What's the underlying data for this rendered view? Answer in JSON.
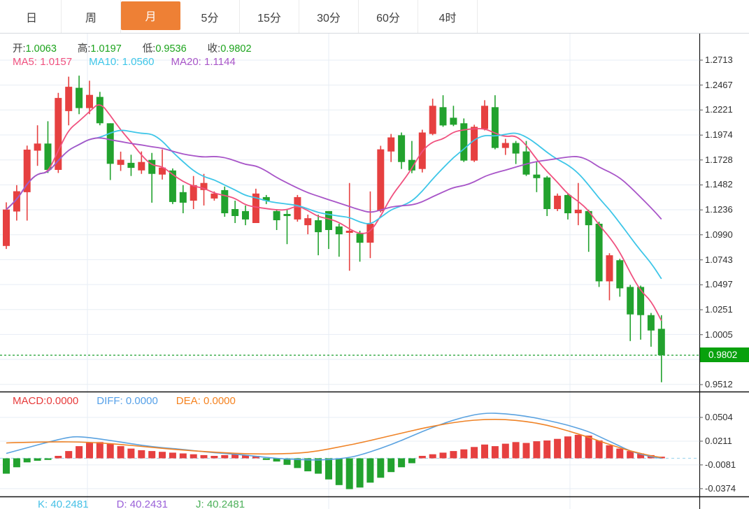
{
  "tabs": {
    "items": [
      {
        "label": "日",
        "selected": false
      },
      {
        "label": "周",
        "selected": false
      },
      {
        "label": "月",
        "selected": true
      },
      {
        "label": "5分",
        "selected": false
      },
      {
        "label": "15分",
        "selected": false
      },
      {
        "label": "30分",
        "selected": false
      },
      {
        "label": "60分",
        "selected": false
      },
      {
        "label": "4时",
        "selected": false
      }
    ]
  },
  "main_chart": {
    "ohlc": {
      "open_label": "开:",
      "open": "1.0063",
      "high_label": "高:",
      "high": "1.0197",
      "low_label": "低:",
      "low": "0.9536",
      "close_label": "收:",
      "close": "0.9802"
    },
    "ma": {
      "ma5_label": "MA5:",
      "ma5": "1.0157",
      "ma10_label": "MA10:",
      "ma10": "1.0560",
      "ma20_label": "MA20:",
      "ma20": "1.1144"
    },
    "y_ticks": [
      "1.2713",
      "1.2467",
      "1.2221",
      "1.1974",
      "1.1728",
      "1.1482",
      "1.1236",
      "1.0990",
      "1.0743",
      "1.0497",
      "1.0251",
      "1.0005",
      "0.9512"
    ],
    "current_price": "0.9802"
  },
  "macd_panel": {
    "macd_label": "MACD:",
    "macd": "0.0000",
    "diff_label": "DIFF:",
    "diff": "0.0000",
    "dea_label": "DEA:",
    "dea": "0.0000",
    "y_ticks": [
      "0.0504",
      "0.0211",
      "-0.0081",
      "-0.0374"
    ]
  },
  "kdj_panel": {
    "k_label": "K:",
    "k": "40.2481",
    "d_label": "D:",
    "d": "40.2431",
    "j_label": "J:",
    "j": "40.2481"
  },
  "colors": {
    "up_red": "#e64040",
    "down_green": "#22a22e",
    "ma5": "#f0517f",
    "ma10": "#3ec6e8",
    "ma20": "#a855c8",
    "diff_line": "#5aa2e0",
    "dea_line": "#ef8327",
    "macd_text": "#e73b3b",
    "diff_text": "#55a0e8",
    "dea_text": "#f5821f",
    "ohlc_value_green": "#1ba31b",
    "label_text": "#3c3c3c",
    "badge_green": "#08a10d",
    "dotted_green": "#2fa640",
    "tab_selected_orange": "#ee8035",
    "k_text": "#45c0e6",
    "d_text": "#9a60d8",
    "j_text": "#4db05a",
    "grid": "#e7edf4",
    "zero_dash": "#a8d8f0",
    "separator": "#141414",
    "axis_text": "#2f2f2f"
  },
  "chart_data": [
    {
      "type": "candlestick",
      "panel": "main",
      "title": "月K线 monthly candles, red = up / green = down",
      "ylim": [
        0.9512,
        1.2713
      ],
      "y_ticks": [
        1.2713,
        1.2467,
        1.2221,
        1.1974,
        1.1728,
        1.1482,
        1.1236,
        1.099,
        1.0743,
        1.0497,
        1.0251,
        1.0005,
        0.9758,
        0.9512
      ],
      "latest": {
        "open": 1.0063,
        "high": 1.0197,
        "low": 0.9536,
        "close": 0.9802
      },
      "ma_latest": {
        "MA5": 1.0157,
        "MA10": 1.056,
        "MA20": 1.1144
      },
      "close_line": 0.9802,
      "ohlc": [
        [
          1.088,
          1.131,
          1.085,
          1.124
        ],
        [
          1.122,
          1.148,
          1.113,
          1.142
        ],
        [
          1.141,
          1.187,
          1.113,
          1.183
        ],
        [
          1.182,
          1.207,
          1.167,
          1.189
        ],
        [
          1.189,
          1.211,
          1.16,
          1.163
        ],
        [
          1.163,
          1.239,
          1.16,
          1.234
        ],
        [
          1.221,
          1.255,
          1.207,
          1.245
        ],
        [
          1.244,
          1.256,
          1.218,
          1.224
        ],
        [
          1.224,
          1.251,
          1.218,
          1.237
        ],
        [
          1.235,
          1.24,
          1.207,
          1.209
        ],
        [
          1.209,
          1.209,
          1.153,
          1.169
        ],
        [
          1.168,
          1.181,
          1.162,
          1.173
        ],
        [
          1.17,
          1.178,
          1.157,
          1.165
        ],
        [
          1.1625,
          1.1812,
          1.1591,
          1.1708
        ],
        [
          1.1729,
          1.1798,
          1.1307,
          1.1591
        ],
        [
          1.1584,
          1.1833,
          1.1535,
          1.1653
        ],
        [
          1.1625,
          1.1645,
          1.1293,
          1.1314
        ],
        [
          1.1411,
          1.148,
          1.1203,
          1.1307
        ],
        [
          1.1327,
          1.157,
          1.1244,
          1.148
        ],
        [
          1.1431,
          1.1591,
          1.1279,
          1.1501
        ],
        [
          1.1348,
          1.1418,
          1.1327,
          1.1397
        ],
        [
          1.1431,
          1.1466,
          1.1168,
          1.1203
        ],
        [
          1.1244,
          1.1327,
          1.1106,
          1.1175
        ],
        [
          1.1224,
          1.1279,
          1.1085,
          1.1141
        ],
        [
          1.1106,
          1.1445,
          1.1106,
          1.1397
        ],
        [
          1.1362,
          1.1383,
          1.1293,
          1.1327
        ],
        [
          1.1224,
          1.1244,
          1.1037,
          1.1134
        ],
        [
          1.1196,
          1.1244,
          1.0898,
          1.1175
        ],
        [
          1.1141,
          1.1383,
          1.112,
          1.1362
        ],
        [
          1.1085,
          1.1189,
          1.0995,
          1.1154
        ],
        [
          1.1134,
          1.1189,
          1.0788,
          1.1016
        ],
        [
          1.1224,
          1.1224,
          1.085,
          1.1037
        ],
        [
          1.1072,
          1.1099,
          1.0774,
          1.0995
        ],
        [
          1.1009,
          1.1501,
          1.0635,
          1.103
        ],
        [
          1.1002,
          1.103,
          1.0725,
          1.0912
        ],
        [
          1.0912,
          1.1418,
          1.076,
          1.1099
        ],
        [
          1.1224,
          1.1868,
          1.121,
          1.1833
        ],
        [
          1.1812,
          1.1985,
          1.1708,
          1.1951
        ],
        [
          1.1972,
          1.1999,
          1.1639,
          1.1708
        ],
        [
          1.1729,
          1.1916,
          1.1598,
          1.1625
        ],
        [
          1.1639,
          1.2027,
          1.1605,
          1.1999
        ],
        [
          1.1985,
          1.2332,
          1.1972,
          1.2263
        ],
        [
          1.2249,
          1.2367,
          1.2055,
          1.2069
        ],
        [
          1.2145,
          1.2263,
          1.2062,
          1.2076
        ],
        [
          1.209,
          1.2138,
          1.1708,
          1.1722
        ],
        [
          1.1722,
          1.2076,
          1.1708,
          1.2055
        ],
        [
          1.2034,
          1.2318,
          1.202,
          1.2263
        ],
        [
          1.2249,
          1.2367,
          1.1833,
          1.1847
        ],
        [
          1.1847,
          1.1937,
          1.1778,
          1.1896
        ],
        [
          1.1896,
          1.1916,
          1.1688,
          1.1792
        ],
        [
          1.1812,
          1.1916,
          1.157,
          1.1584
        ],
        [
          1.1584,
          1.1708,
          1.1411,
          1.1549
        ],
        [
          1.1556,
          1.157,
          1.1175,
          1.1244
        ],
        [
          1.1244,
          1.1397,
          1.1224,
          1.1376
        ],
        [
          1.1383,
          1.1397,
          1.1141,
          1.1203
        ],
        [
          1.1203,
          1.1501,
          1.1085,
          1.1238
        ],
        [
          1.1224,
          1.1238,
          1.0822,
          1.1085
        ],
        [
          1.1099,
          1.112,
          1.0476,
          1.0531
        ],
        [
          1.0531,
          1.0808,
          1.0344,
          1.0788
        ],
        [
          1.0739,
          1.0753,
          1.0379,
          1.0462
        ],
        [
          1.0476,
          1.0496,
          0.9942,
          1.0205
        ],
        [
          1.0476,
          1.0489,
          0.9956,
          1.0198
        ],
        [
          1.0198,
          1.0219,
          0.9886,
          1.0046
        ],
        [
          1.0063,
          1.0197,
          0.9536,
          0.9802
        ]
      ]
    },
    {
      "type": "bar",
      "panel": "macd",
      "title": "MACD histogram with DIFF/DEA lines",
      "y_ticks": [
        0.0504,
        0.0211,
        -0.0081,
        -0.0374
      ],
      "latest": {
        "MACD": 0.0,
        "DIFF": 0.0,
        "DEA": 0.0
      },
      "histogram": [
        -0.019,
        -0.011,
        -0.005,
        -0.003,
        -0.002,
        0.003,
        0.009,
        0.015,
        0.019,
        0.02,
        0.018,
        0.015,
        0.012,
        0.01,
        0.009,
        0.008,
        0.007,
        0.006,
        0.005,
        0.004,
        0.003,
        0.004,
        0.005,
        0.004,
        0.003,
        -0.002,
        -0.004,
        -0.008,
        -0.012,
        -0.016,
        -0.019,
        -0.026,
        -0.033,
        -0.038,
        -0.036,
        -0.03,
        -0.024,
        -0.017,
        -0.011,
        -0.006,
        0.003,
        0.005,
        0.007,
        0.009,
        0.011,
        0.014,
        0.017,
        0.015,
        0.018,
        0.02,
        0.019,
        0.021,
        0.022,
        0.024,
        0.027,
        0.029,
        0.028,
        0.022,
        0.016,
        0.012,
        0.009,
        0.006,
        0.004,
        0.002
      ],
      "diff_points": [
        [
          0,
          0.006
        ],
        [
          2,
          0.013
        ],
        [
          4,
          0.02
        ],
        [
          6,
          0.026
        ],
        [
          7,
          0.027
        ],
        [
          9,
          0.024
        ],
        [
          11,
          0.02
        ],
        [
          13,
          0.016
        ],
        [
          15,
          0.013
        ],
        [
          17,
          0.011
        ],
        [
          19,
          0.008
        ],
        [
          21,
          0.006
        ],
        [
          23,
          0.004
        ],
        [
          25,
          0.001
        ],
        [
          27,
          -0.001
        ],
        [
          29,
          -0.002
        ],
        [
          31,
          -0.002
        ],
        [
          33,
          0.001
        ],
        [
          34,
          0.004
        ],
        [
          36,
          0.012
        ],
        [
          38,
          0.022
        ],
        [
          40,
          0.033
        ],
        [
          42,
          0.043
        ],
        [
          44,
          0.051
        ],
        [
          46,
          0.056
        ],
        [
          48,
          0.055
        ],
        [
          50,
          0.052
        ],
        [
          52,
          0.047
        ],
        [
          54,
          0.041
        ],
        [
          56,
          0.033
        ],
        [
          57,
          0.027
        ],
        [
          58,
          0.021
        ],
        [
          59,
          0.015
        ],
        [
          60,
          0.009
        ],
        [
          61,
          0.005
        ],
        [
          62,
          0.002
        ],
        [
          63,
          0.0
        ]
      ],
      "dea_points": [
        [
          0,
          0.019
        ],
        [
          4,
          0.0205
        ],
        [
          8,
          0.02
        ],
        [
          12,
          0.016
        ],
        [
          16,
          0.011
        ],
        [
          20,
          0.0075
        ],
        [
          24,
          0.005
        ],
        [
          28,
          0.006
        ],
        [
          30,
          0.009
        ],
        [
          32,
          0.014
        ],
        [
          34,
          0.019
        ],
        [
          36,
          0.025
        ],
        [
          38,
          0.031
        ],
        [
          40,
          0.037
        ],
        [
          42,
          0.042
        ],
        [
          44,
          0.046
        ],
        [
          46,
          0.048
        ],
        [
          48,
          0.048
        ],
        [
          50,
          0.0455
        ],
        [
          52,
          0.041
        ],
        [
          54,
          0.034
        ],
        [
          56,
          0.026
        ],
        [
          58,
          0.017
        ],
        [
          60,
          0.009
        ],
        [
          62,
          0.003
        ],
        [
          63,
          0.001
        ]
      ]
    }
  ]
}
